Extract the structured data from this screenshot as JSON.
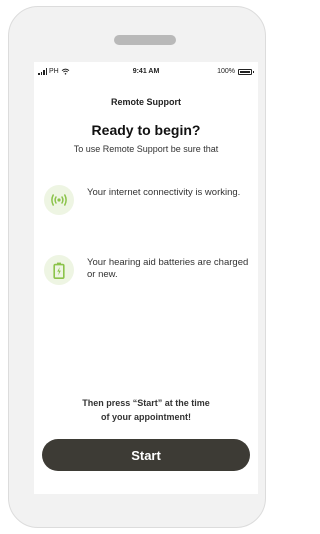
{
  "status_bar": {
    "carrier": "PH",
    "time": "9:41 AM",
    "battery_percent": "100%"
  },
  "header": {
    "title": "Remote Support"
  },
  "main": {
    "heading": "Ready to begin?",
    "subheading": "To use Remote Support be sure that",
    "items": [
      {
        "icon": "wireless-signal-icon",
        "text": "Your internet connectivity is working."
      },
      {
        "icon": "battery-charging-icon",
        "text": "Your hearing aid batteries are charged or new."
      }
    ],
    "footer_note_line1": "Then press “Start” at the time",
    "footer_note_line2": "of your appointment!"
  },
  "actions": {
    "start_label": "Start"
  },
  "colors": {
    "accent": "#8bc34a",
    "icon_background": "#eef5e3",
    "button": "#3d3b35"
  }
}
